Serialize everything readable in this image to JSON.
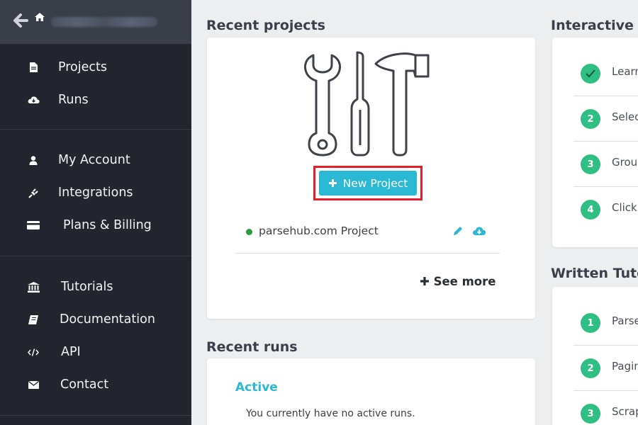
{
  "sidebar": {
    "groups": [
      {
        "items": [
          {
            "label": "Projects",
            "icon": "document-icon"
          },
          {
            "label": "Runs",
            "icon": "cloud-download-icon"
          }
        ]
      },
      {
        "items": [
          {
            "label": "My Account",
            "icon": "user-icon"
          },
          {
            "label": "Integrations",
            "icon": "plug-icon"
          },
          {
            "label": "Plans & Billing",
            "icon": "credit-card-icon"
          }
        ]
      },
      {
        "items": [
          {
            "label": "Tutorials",
            "icon": "bank-icon"
          },
          {
            "label": "Documentation",
            "icon": "book-icon"
          },
          {
            "label": "API",
            "icon": "code-icon"
          },
          {
            "label": "Contact",
            "icon": "envelope-icon"
          }
        ]
      }
    ]
  },
  "recent_projects": {
    "title": "Recent projects",
    "new_project_label": "New Project",
    "project_name": "parsehub.com Project",
    "see_more_label": "See more"
  },
  "recent_runs": {
    "title": "Recent runs",
    "active_label": "Active",
    "empty_text": "You currently have no active runs."
  },
  "interactive_tutorials": {
    "title": "Interactive T",
    "items": [
      {
        "badge": "",
        "label": "Learn"
      },
      {
        "badge": "2",
        "label": "Selec"
      },
      {
        "badge": "3",
        "label": "Grou"
      },
      {
        "badge": "4",
        "label": "Click"
      }
    ]
  },
  "written_tutorials": {
    "title": "Written Tuto",
    "items": [
      {
        "badge": "1",
        "label": "Parse"
      },
      {
        "badge": "2",
        "label": "Pagin"
      },
      {
        "badge": "3",
        "label": "Scrap"
      }
    ]
  },
  "colors": {
    "sidebar": "#23262f",
    "accent": "#2bb8d2",
    "badge": "#2fbf85",
    "highlight": "#e3202a"
  }
}
